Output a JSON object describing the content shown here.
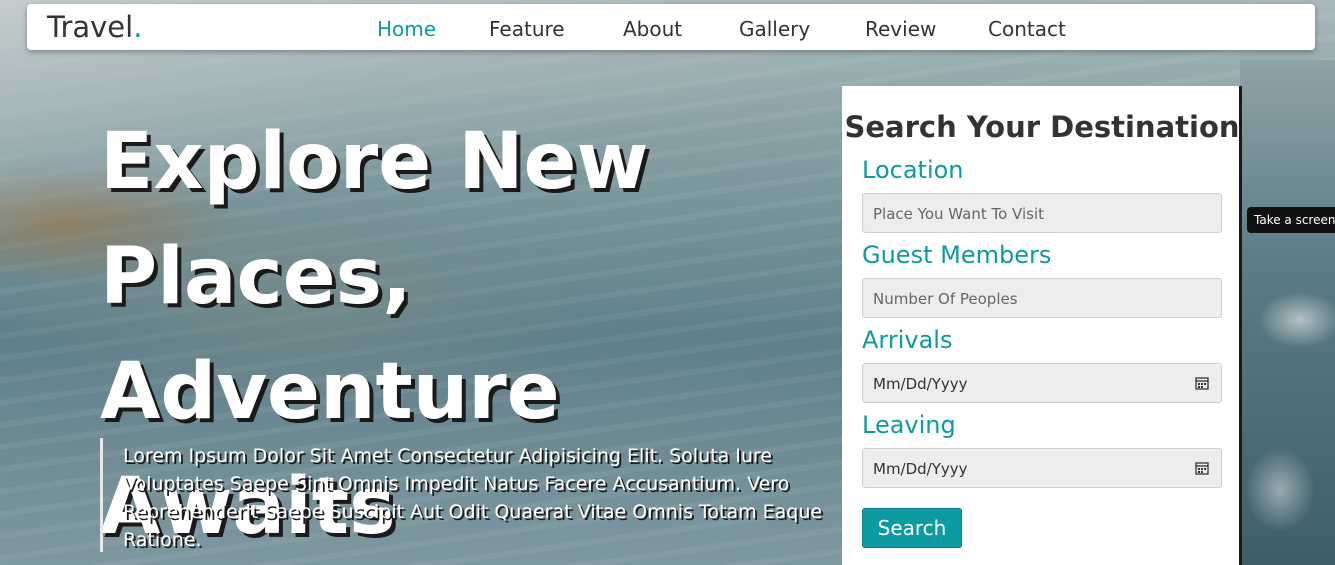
{
  "nav": {
    "logo_text": "Travel",
    "logo_dot": ".",
    "links": [
      {
        "label": "Home",
        "active": true
      },
      {
        "label": "Feature",
        "active": false
      },
      {
        "label": "About",
        "active": false
      },
      {
        "label": "Gallery",
        "active": false
      },
      {
        "label": "Review",
        "active": false
      },
      {
        "label": "Contact",
        "active": false
      }
    ]
  },
  "hero": {
    "title_line1": "Explore New",
    "title_line2": "Places,",
    "title_line3": "Adventure Awaits",
    "description": "Lorem Ipsum Dolor Sit Amet Consectetur Adipisicing Elit. Soluta Iure Voluptates Saepe Sint Omnis Impedit Natus Facere Accusantium. Vero Reprehenderit Saepe Suscipit Aut Odit Quaerat Vitae Omnis Totam Eaque Ratione."
  },
  "form": {
    "title": "Search Your Destination",
    "location_label": "Location",
    "location_placeholder": "Place You Want To Visit",
    "guests_label": "Guest Members",
    "guests_placeholder": "Number Of Peoples",
    "arrivals_label": "Arrivals",
    "arrivals_value": "Mm/Dd/Yyyy",
    "leaving_label": "Leaving",
    "leaving_value": "Mm/Dd/Yyyy",
    "search_label": "Search"
  },
  "tooltip": {
    "text": "Take a screens"
  },
  "colors": {
    "accent": "#0b9ba0",
    "text_dark": "#333333"
  },
  "icons": {
    "date_picker": "calendar-icon"
  }
}
